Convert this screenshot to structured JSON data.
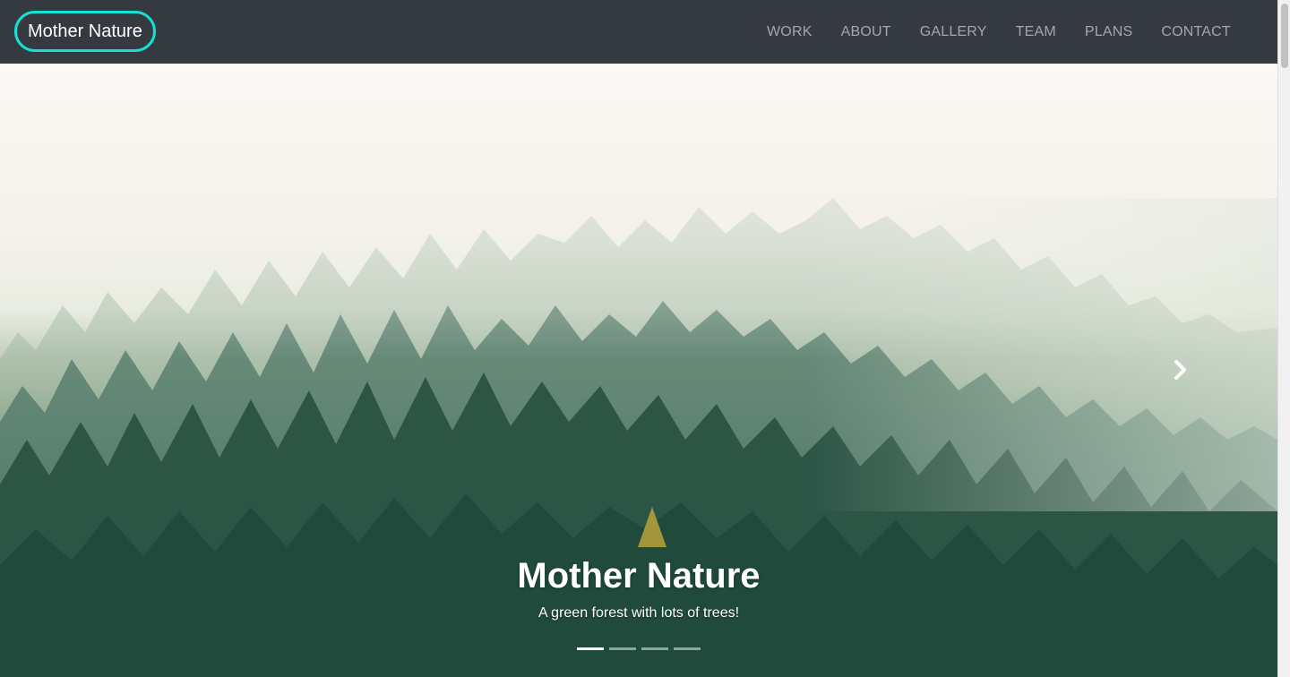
{
  "brand": {
    "label": "Mother Nature",
    "border_color": "#14e0d3"
  },
  "nav": {
    "items": [
      {
        "label": "WORK"
      },
      {
        "label": "ABOUT"
      },
      {
        "label": "GALLERY"
      },
      {
        "label": "TEAM"
      },
      {
        "label": "PLANS"
      },
      {
        "label": "CONTACT"
      }
    ]
  },
  "carousel": {
    "title": "Mother Nature",
    "subtitle": "A green forest with lots of trees!",
    "slide_count": 4,
    "active_slide": 1,
    "next_icon": "chevron-right-icon"
  },
  "colors": {
    "navbar_bg": "#343a40",
    "nav_text": "#9a9da1",
    "forest_dark": "#1f4a3c"
  }
}
